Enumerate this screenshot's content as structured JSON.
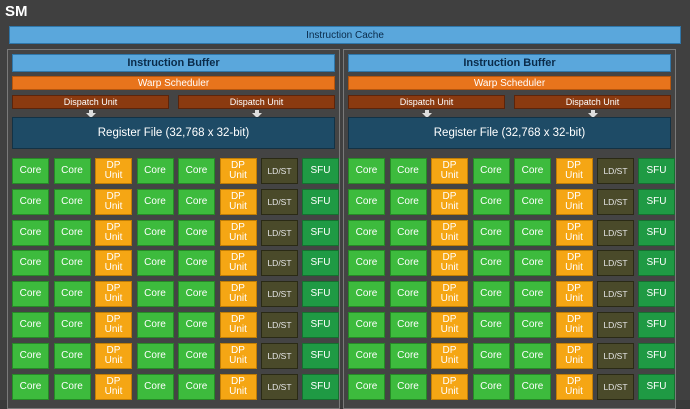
{
  "sm": {
    "title": "SM",
    "instruction_cache": "Instruction Cache"
  },
  "half": {
    "instruction_buffer": "Instruction Buffer",
    "warp_scheduler": "Warp Scheduler",
    "dispatch_unit": "Dispatch Unit",
    "register_file": "Register File (32,768 x 32-bit)"
  },
  "units": {
    "core": "Core",
    "dp_line1": "DP",
    "dp_line2": "Unit",
    "ldst": "LD/ST",
    "sfu": "SFU"
  },
  "row_pattern": [
    "core",
    "core",
    "dp",
    "core",
    "core",
    "dp",
    "ldst",
    "sfu"
  ],
  "rows_visible": 8,
  "colors": {
    "core": "#3dbb3d",
    "dp": "#f5a614",
    "ldst": "#4a4a2a",
    "sfu": "#1f9a44",
    "cache": "#5aa7dc",
    "warp": "#e8741c",
    "dispatch": "#8a3a10",
    "register": "#1e4b66"
  }
}
